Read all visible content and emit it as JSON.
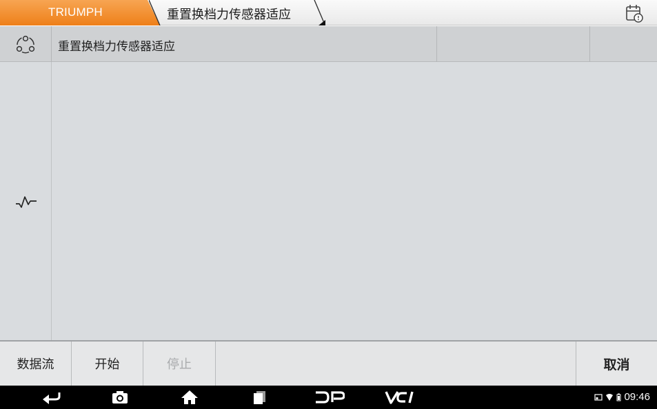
{
  "header": {
    "brand_tab": "TRIUMPH",
    "page_tab": "重置换档力传感器适应",
    "brand_color": "#f08a24"
  },
  "row": {
    "title": "重置换档力传感器适应",
    "icon": "share-cycle-icon"
  },
  "side": {
    "icon": "waveform-icon"
  },
  "actions": {
    "datastream": "数据流",
    "start": "开始",
    "stop": "停止",
    "cancel": "取消"
  },
  "navbar": {
    "icons": [
      "back-icon",
      "camera-icon",
      "home-icon",
      "recent-apps-icon",
      "dp-logo-icon",
      "vci-logo-icon"
    ],
    "time": "09:46"
  }
}
